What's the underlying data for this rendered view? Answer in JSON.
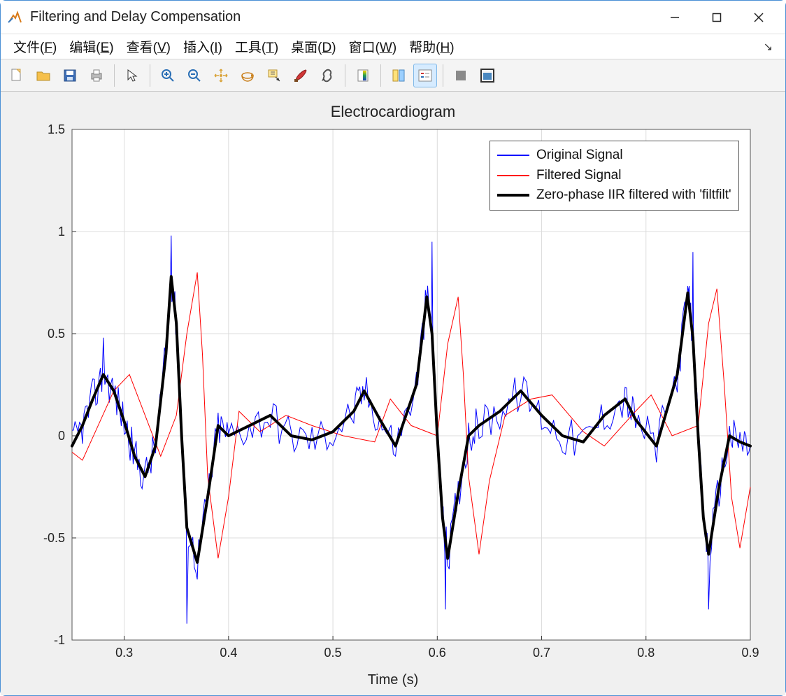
{
  "window": {
    "title": "Filtering and Delay Compensation"
  },
  "menu": {
    "file": {
      "label": "文件",
      "accel": "F"
    },
    "edit": {
      "label": "编辑",
      "accel": "E"
    },
    "view": {
      "label": "查看",
      "accel": "V"
    },
    "insert": {
      "label": "插入",
      "accel": "I"
    },
    "tools": {
      "label": "工具",
      "accel": "T"
    },
    "desktop": {
      "label": "桌面",
      "accel": "D"
    },
    "window": {
      "label": "窗口",
      "accel": "W"
    },
    "help": {
      "label": "帮助",
      "accel": "H"
    }
  },
  "toolbar_icons": [
    "new-file-icon",
    "open-file-icon",
    "save-icon",
    "print-icon",
    "|",
    "pointer-icon",
    "|",
    "zoom-in-icon",
    "zoom-out-icon",
    "pan-icon",
    "rotate3d-icon",
    "data-cursor-icon",
    "brush-icon",
    "link-icon",
    "|",
    "colorbar-icon",
    "|",
    "hide-plot-icon",
    "legend-icon",
    "|",
    "stop-icon",
    "dock-icon"
  ],
  "chart_data": {
    "type": "line",
    "title": "Electrocardiogram",
    "xlabel": "Time (s)",
    "ylabel": "",
    "xlim": [
      0.25,
      0.9
    ],
    "ylim": [
      -1.0,
      1.5
    ],
    "xticks": [
      0.3,
      0.4,
      0.5,
      0.6,
      0.7,
      0.8,
      0.9
    ],
    "yticks": [
      -1,
      -0.5,
      0,
      0.5,
      1,
      1.5
    ],
    "legend": {
      "position": "upper-right-inside",
      "entries": [
        {
          "name": "Original Signal",
          "color": "#0000ff",
          "width": 1
        },
        {
          "name": "Filtered Signal",
          "color": "#ff0000",
          "width": 1
        },
        {
          "name": "Zero-phase IIR filtered with 'filtfilt'",
          "color": "#000000",
          "width": 4
        }
      ]
    },
    "series": [
      {
        "name": "Zero-phase IIR filtered with 'filtfilt'",
        "color": "#000000",
        "width": 4,
        "x": [
          0.25,
          0.26,
          0.27,
          0.28,
          0.29,
          0.3,
          0.31,
          0.32,
          0.33,
          0.34,
          0.345,
          0.35,
          0.355,
          0.36,
          0.37,
          0.38,
          0.39,
          0.4,
          0.42,
          0.44,
          0.46,
          0.48,
          0.5,
          0.52,
          0.53,
          0.545,
          0.56,
          0.58,
          0.59,
          0.595,
          0.6,
          0.605,
          0.61,
          0.62,
          0.63,
          0.64,
          0.66,
          0.68,
          0.7,
          0.72,
          0.74,
          0.76,
          0.78,
          0.79,
          0.81,
          0.83,
          0.84,
          0.845,
          0.85,
          0.855,
          0.86,
          0.87,
          0.88,
          0.89,
          0.9
        ],
        "y": [
          -0.05,
          0.05,
          0.18,
          0.3,
          0.22,
          0.07,
          -0.1,
          -0.2,
          -0.05,
          0.4,
          0.78,
          0.55,
          0.0,
          -0.45,
          -0.62,
          -0.3,
          0.05,
          0.0,
          0.05,
          0.1,
          0.0,
          -0.02,
          0.02,
          0.12,
          0.22,
          0.08,
          -0.05,
          0.25,
          0.68,
          0.5,
          0.0,
          -0.4,
          -0.6,
          -0.28,
          0.0,
          0.05,
          0.12,
          0.22,
          0.1,
          0.0,
          -0.03,
          0.1,
          0.18,
          0.08,
          -0.05,
          0.3,
          0.7,
          0.48,
          0.0,
          -0.4,
          -0.58,
          -0.25,
          0.0,
          -0.03,
          -0.05
        ]
      },
      {
        "name": "Filtered Signal",
        "color": "#ff0000",
        "width": 1,
        "x": [
          0.25,
          0.26,
          0.275,
          0.29,
          0.305,
          0.32,
          0.335,
          0.35,
          0.36,
          0.37,
          0.375,
          0.38,
          0.39,
          0.4,
          0.41,
          0.43,
          0.455,
          0.48,
          0.51,
          0.54,
          0.555,
          0.575,
          0.6,
          0.61,
          0.62,
          0.625,
          0.63,
          0.64,
          0.65,
          0.665,
          0.69,
          0.71,
          0.74,
          0.76,
          0.79,
          0.805,
          0.825,
          0.85,
          0.86,
          0.868,
          0.875,
          0.882,
          0.89,
          0.9
        ],
        "y": [
          -0.08,
          -0.12,
          0.05,
          0.22,
          0.3,
          0.1,
          -0.1,
          0.1,
          0.5,
          0.8,
          0.4,
          -0.2,
          -0.6,
          -0.3,
          0.12,
          0.02,
          0.1,
          0.05,
          0.0,
          -0.03,
          0.18,
          0.05,
          0.0,
          0.45,
          0.68,
          0.3,
          -0.2,
          -0.58,
          -0.22,
          0.1,
          0.18,
          0.2,
          0.02,
          -0.05,
          0.12,
          0.2,
          0.0,
          0.05,
          0.55,
          0.72,
          0.25,
          -0.3,
          -0.55,
          -0.25
        ]
      },
      {
        "name": "Original Signal",
        "color": "#0000ff",
        "width": 1,
        "noisy_around": "series0",
        "noise_amp": 0.1,
        "peaks_x": [
          0.28,
          0.345,
          0.36,
          0.595,
          0.608,
          0.845,
          0.86
        ],
        "peaks_y": [
          0.48,
          0.98,
          -0.92,
          0.95,
          -0.85,
          0.9,
          -0.85
        ]
      }
    ]
  }
}
